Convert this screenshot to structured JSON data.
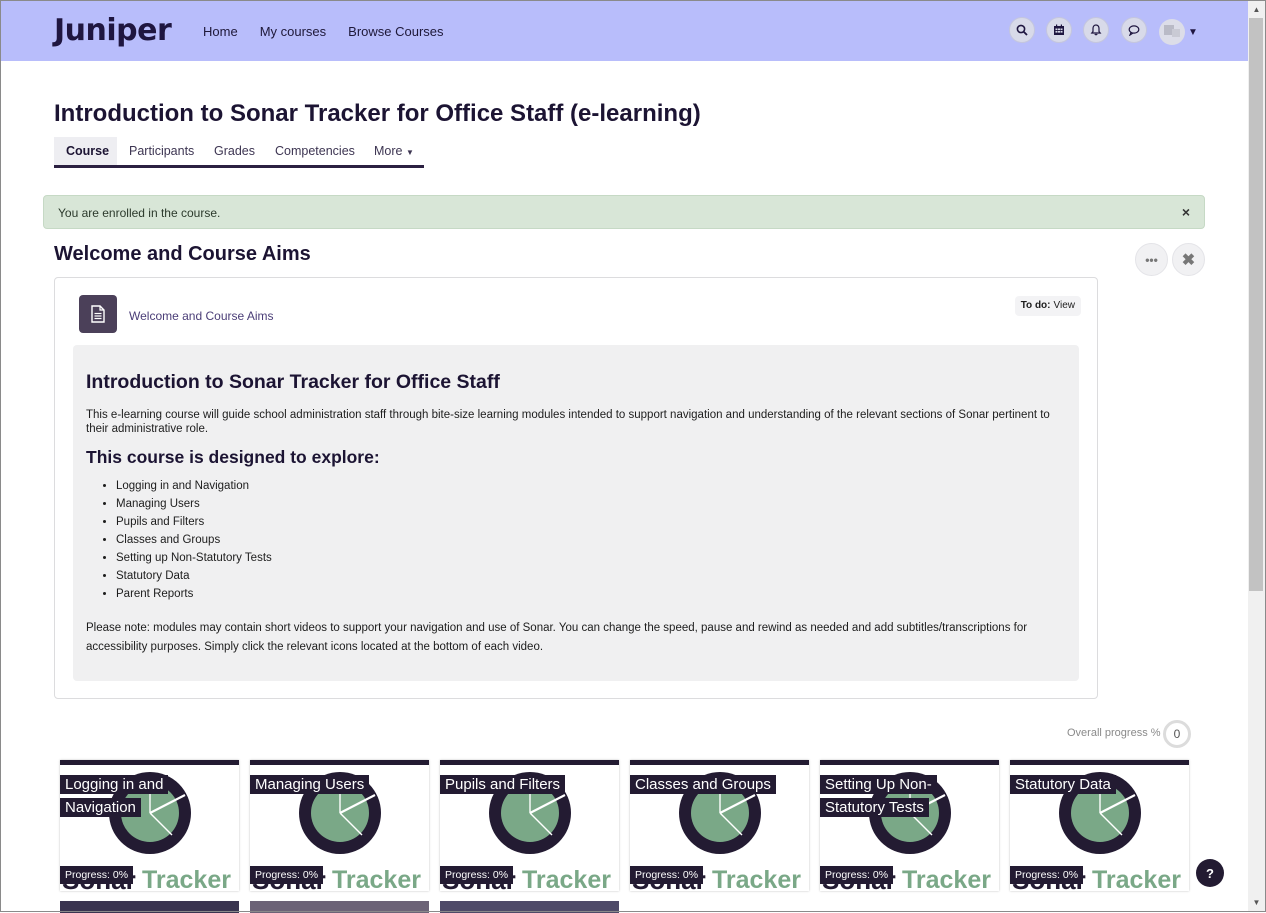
{
  "brand": {
    "logo": "Juniper"
  },
  "nav": {
    "links": [
      "Home",
      "My courses",
      "Browse Courses"
    ],
    "icons": [
      "search-icon",
      "calendar-icon",
      "bell-icon",
      "chat-icon"
    ]
  },
  "page": {
    "title": "Introduction to Sonar Tracker for Office Staff (e-learning)",
    "tabs": [
      "Course",
      "Participants",
      "Grades",
      "Competencies",
      "More"
    ],
    "active_tab": "Course"
  },
  "alert": {
    "text": "You are enrolled in the course.",
    "close": "×"
  },
  "section": {
    "title": "Welcome and Course Aims",
    "activity": {
      "name": "Welcome and Course Aims",
      "todo_label": "To do:",
      "todo_value": "View"
    },
    "content": {
      "heading": "Introduction to Sonar Tracker for Office Staff",
      "intro": "This e-learning course will guide school administration staff through bite-size learning modules intended to support navigation and understanding of the relevant sections of Sonar pertinent to their administrative role.",
      "explore_heading": "This course is designed to explore:",
      "topics": [
        "Logging in and Navigation",
        "Managing Users",
        "Pupils and Filters",
        "Classes and Groups",
        "Setting up Non-Statutory Tests",
        "Statutory Data",
        "Parent Reports"
      ],
      "note": "Please note: modules may contain short videos to support your navigation and use of Sonar. You can change the speed, pause and rewind as needed and add subtitles/transcriptions for accessibility purposes. Simply click the relevant icons located at the bottom of each video."
    }
  },
  "progress": {
    "label": "Overall progress %",
    "value": "0"
  },
  "tiles": [
    {
      "title_lines": [
        "Logging in and",
        "Navigation"
      ],
      "progress": "Progress: 0%",
      "watermark": "Tracker"
    },
    {
      "title_lines": [
        "Managing Users"
      ],
      "progress": "Progress: 0%",
      "watermark": "Tracker"
    },
    {
      "title_lines": [
        "Pupils and Filters"
      ],
      "progress": "Progress: 0%",
      "watermark": "Tracker"
    },
    {
      "title_lines": [
        "Classes and Groups"
      ],
      "progress": "Progress: 0%",
      "watermark": "Tracker"
    },
    {
      "title_lines": [
        "Setting Up Non-",
        "Statutory Tests"
      ],
      "progress": "Progress: 0%",
      "watermark": "Tracker"
    },
    {
      "title_lines": [
        "Statutory Data"
      ],
      "progress": "Progress: 0%",
      "watermark": "Tracker"
    }
  ],
  "help": {
    "label": "?"
  },
  "colors": {
    "navbar": "#b8bdfb",
    "primary": "#231b32",
    "tracker_green": "#7aa887",
    "alert_bg": "#d8e6d7"
  }
}
